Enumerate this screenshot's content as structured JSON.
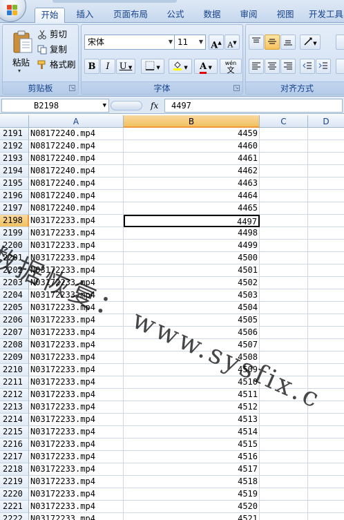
{
  "ribbon": {
    "tabs": [
      "开始",
      "插入",
      "页面布局",
      "公式",
      "数据",
      "审阅",
      "视图",
      "开发工具"
    ],
    "active_tab": "开始",
    "clipboard": {
      "paste": "粘贴",
      "cut": "剪切",
      "copy": "复制",
      "format_painter": "格式刷",
      "title": "剪贴板"
    },
    "font": {
      "name": "宋体",
      "size": "11",
      "grow": "A",
      "shrink": "A",
      "bold": "B",
      "italic": "I",
      "underline": "U",
      "font_color_letter": "A",
      "phonetic": "wén",
      "phonetic_char": "文",
      "title": "字体"
    },
    "alignment": {
      "title": "对齐方式"
    }
  },
  "formula_bar": {
    "name_box": "B2198",
    "fx": "fx",
    "value": "4497"
  },
  "sheet": {
    "columns": [
      "A",
      "B",
      "C",
      "D"
    ],
    "selected_column": "B",
    "selected_row": "2198",
    "rows": [
      {
        "n": "2191",
        "a": "N08172240.mp4",
        "b": "4459"
      },
      {
        "n": "2192",
        "a": "N08172240.mp4",
        "b": "4460"
      },
      {
        "n": "2193",
        "a": "N08172240.mp4",
        "b": "4461"
      },
      {
        "n": "2194",
        "a": "N08172240.mp4",
        "b": "4462"
      },
      {
        "n": "2195",
        "a": "N08172240.mp4",
        "b": "4463"
      },
      {
        "n": "2196",
        "a": "N08172240.mp4",
        "b": "4464"
      },
      {
        "n": "2197",
        "a": "N08172240.mp4",
        "b": "4465"
      },
      {
        "n": "2198",
        "a": "N03172233.mp4",
        "b": "4497"
      },
      {
        "n": "2199",
        "a": "N03172233.mp4",
        "b": "4498"
      },
      {
        "n": "2200",
        "a": "N03172233.mp4",
        "b": "4499"
      },
      {
        "n": "2201",
        "a": "N03172233.mp4",
        "b": "4500"
      },
      {
        "n": "2202",
        "a": "N03172233.mp4",
        "b": "4501"
      },
      {
        "n": "2203",
        "a": "N03172233.mp4",
        "b": "4502"
      },
      {
        "n": "2204",
        "a": "N03172233.mp4",
        "b": "4503"
      },
      {
        "n": "2205",
        "a": "N03172233.mp4",
        "b": "4504"
      },
      {
        "n": "2206",
        "a": "N03172233.mp4",
        "b": "4505"
      },
      {
        "n": "2207",
        "a": "N03172233.mp4",
        "b": "4506"
      },
      {
        "n": "2208",
        "a": "N03172233.mp4",
        "b": "4507"
      },
      {
        "n": "2209",
        "a": "N03172233.mp4",
        "b": "4508"
      },
      {
        "n": "2210",
        "a": "N03172233.mp4",
        "b": "4509"
      },
      {
        "n": "2211",
        "a": "N03172233.mp4",
        "b": "4510"
      },
      {
        "n": "2212",
        "a": "N03172233.mp4",
        "b": "4511"
      },
      {
        "n": "2213",
        "a": "N03172233.mp4",
        "b": "4512"
      },
      {
        "n": "2214",
        "a": "N03172233.mp4",
        "b": "4513"
      },
      {
        "n": "2215",
        "a": "N03172233.mp4",
        "b": "4514"
      },
      {
        "n": "2216",
        "a": "N03172233.mp4",
        "b": "4515"
      },
      {
        "n": "2217",
        "a": "N03172233.mp4",
        "b": "4516"
      },
      {
        "n": "2218",
        "a": "N03172233.mp4",
        "b": "4517"
      },
      {
        "n": "2219",
        "a": "N03172233.mp4",
        "b": "4518"
      },
      {
        "n": "2220",
        "a": "N03172233.mp4",
        "b": "4519"
      },
      {
        "n": "2221",
        "a": "N03172233.mp4",
        "b": "4520"
      },
      {
        "n": "2222",
        "a": "N03172233.mp4",
        "b": "4521"
      }
    ]
  },
  "watermark": "数据恢复： www.sysfix.c",
  "colors": {
    "accent": "#15428b",
    "selection": "#f1c15f"
  }
}
